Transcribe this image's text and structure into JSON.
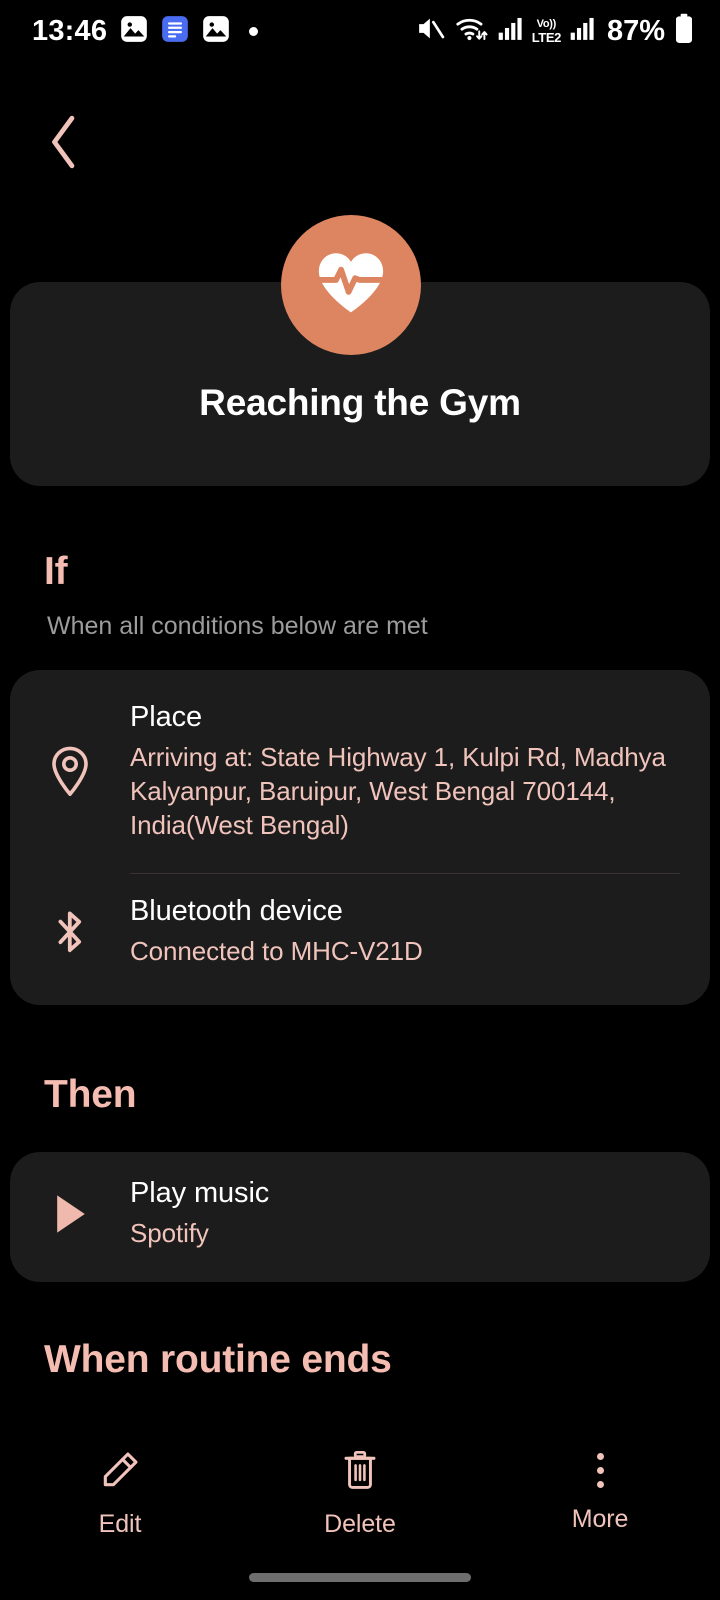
{
  "status_bar": {
    "time": "13:46",
    "left_icons": [
      "image-icon",
      "document-icon",
      "image-icon",
      "dot-indicator"
    ],
    "right_icons": [
      "mute-icon",
      "wifi-icon",
      "signal-icon",
      "volte-icon",
      "signal-icon",
      "battery-icon"
    ],
    "volte_top": "Vo))",
    "volte_bottom": "LTE2",
    "battery_percent": "87%"
  },
  "nav": {
    "back_icon": "chevron-left-icon"
  },
  "header": {
    "avatar_icon": "heart-pulse-icon",
    "title": "Reaching the Gym",
    "accent_color": "#dd8560"
  },
  "sections": {
    "if": {
      "title": "If",
      "subtitle": "When all conditions below are met",
      "conditions": [
        {
          "icon": "location-pin-icon",
          "title": "Place",
          "description": "Arriving at: State Highway 1, Kulpi Rd, Madhya Kalyanpur, Baruipur, West Bengal 700144, India(West Bengal)"
        },
        {
          "icon": "bluetooth-icon",
          "title": "Bluetooth device",
          "description": "Connected to MHC-V21D"
        }
      ]
    },
    "then": {
      "title": "Then",
      "actions": [
        {
          "icon": "play-icon",
          "title": "Play music",
          "description": "Spotify"
        }
      ]
    },
    "when_routine_ends": {
      "title": "When routine ends"
    }
  },
  "bottom_bar": {
    "items": [
      {
        "icon": "pencil-icon",
        "label": "Edit"
      },
      {
        "icon": "trash-icon",
        "label": "Delete"
      },
      {
        "icon": "more-vertical-icon",
        "label": "More"
      }
    ]
  },
  "theme": {
    "background": "#000000",
    "card_background": "#1c1c1c",
    "accent_pink": "#f5bdb2",
    "text_pink": "#f0c3bb",
    "muted_text": "#9c9c9c"
  }
}
